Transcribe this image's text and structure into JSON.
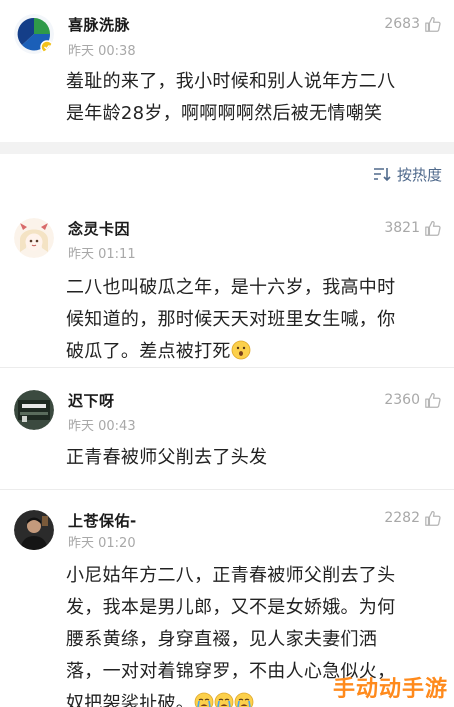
{
  "comments": [
    {
      "username": "喜脉洗脉",
      "time": "昨天 00:38",
      "likes": "2683",
      "lines": [
        "羞耻的来了，我小时候和别人说年方二八",
        "是年龄28岁，啊啊啊啊然后被无情嘲笑"
      ],
      "avatar_colors": [
        "#2f9a4a",
        "#1b5fb8",
        "#f2c21b"
      ]
    },
    {
      "username": "念灵卡因",
      "time": "昨天 01:11",
      "likes": "3821",
      "lines": [
        "二八也叫破瓜之年，是十六岁，我高中时",
        "候知道的，那时候天天对班里女生喊，你",
        "破瓜了。差点被打死"
      ],
      "emoji": "surprised-face-emoji"
    },
    {
      "username": "迟下呀",
      "time": "昨天 00:43",
      "likes": "2360",
      "lines": [
        "正青春被师父削去了头发"
      ]
    },
    {
      "username": "上苍保佑-",
      "time": "昨天 01:20",
      "likes": "2282",
      "lines": [
        "小尼姑年方二八，正青春被师父削去了头",
        "发，我本是男儿郎，又不是女娇娥。为何",
        "腰系黄绦，身穿直裰，见人家夫妻们洒",
        "落，一对对着锦穿罗，不由人心急似火，",
        "奴把袈裟扯破。"
      ],
      "emoji": "crying-face-emoji"
    }
  ],
  "sort": {
    "label": "按热度",
    "icon": "sort-icon"
  },
  "watermark": "手动动手游",
  "colors": {
    "link": "#506a8c",
    "meta": "#a8a8a8",
    "watermark": "#ff8a1c"
  }
}
